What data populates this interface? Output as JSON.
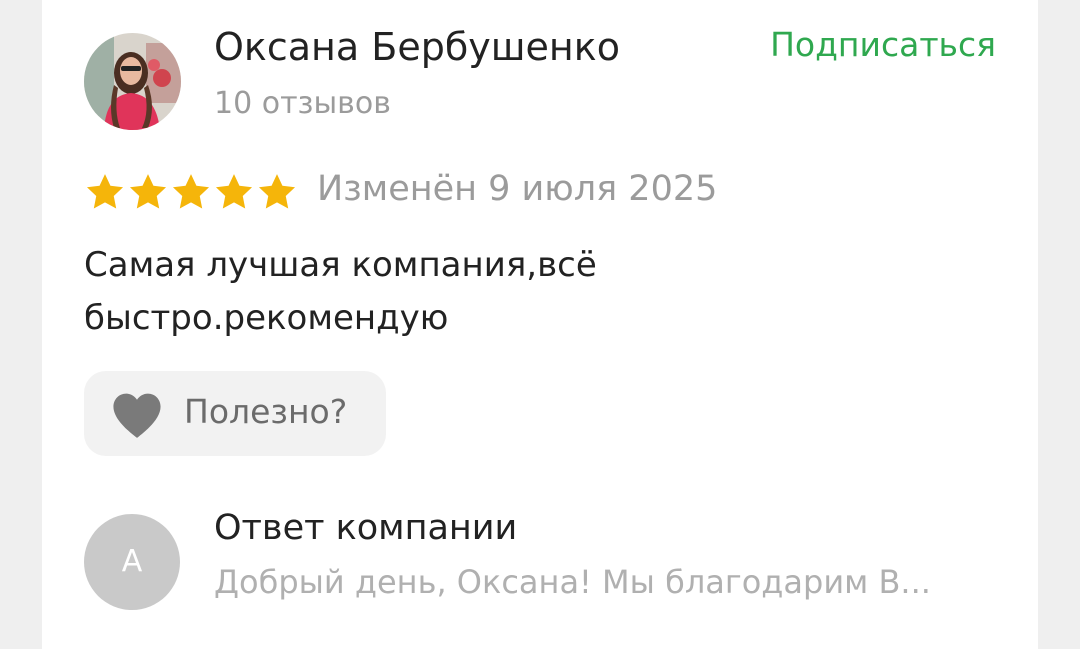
{
  "review": {
    "author_name": "Оксана Бербушенко",
    "review_count": "10 отзывов",
    "subscribe_label": "Подписаться",
    "rating": 5,
    "rating_max": 5,
    "date": "Изменён 9 июля 2025",
    "text": "Самая лучшая компания,всё быстро.рекомендую",
    "helpful_label": "Полезно?"
  },
  "company_reply": {
    "avatar_letter": "А",
    "title": "Ответ компании",
    "text_preview": "Добрый день, Оксана! Мы благодарим В..."
  },
  "colors": {
    "accent_green": "#2fa84f",
    "star_yellow": "#f5b50a",
    "muted_text": "#9b9b9b",
    "heart_gray": "#7a7a7a"
  },
  "icons": {
    "star": "star-icon",
    "heart": "heart-icon"
  }
}
